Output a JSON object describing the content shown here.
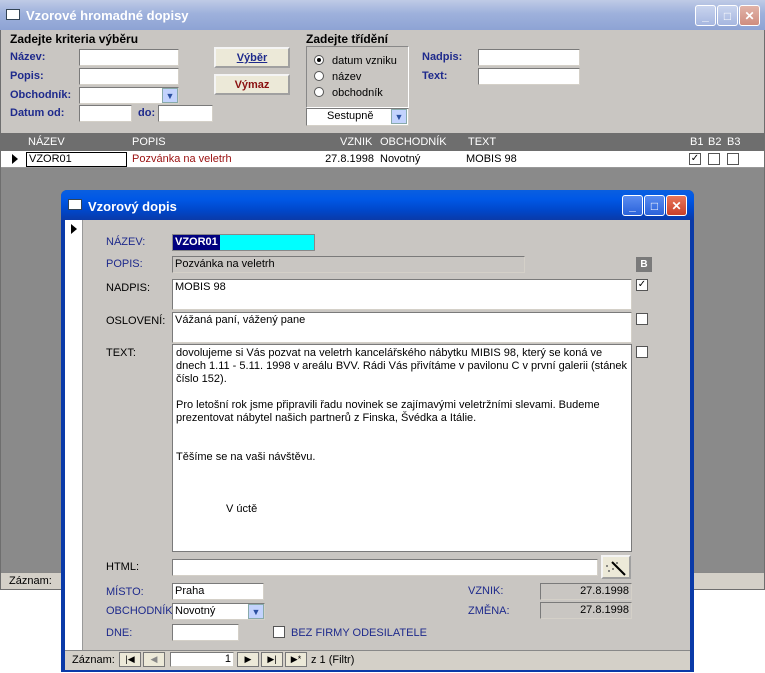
{
  "main_window": {
    "title": "Vzorové hromadné dopisy",
    "criteria": {
      "heading": "Zadejte kriteria výběru",
      "nazev_label": "Název:",
      "popis_label": "Popis:",
      "obchodnik_label": "Obchodník:",
      "datum_od_label": "Datum od:",
      "do_label": "do:"
    },
    "buttons": {
      "vyber": "Výběr",
      "vymaz": "Výmaz"
    },
    "sorting": {
      "heading": "Zadejte třídění",
      "options": [
        "datum vzniku",
        "název",
        "obchodník"
      ],
      "selected": 0,
      "order": "Sestupně"
    },
    "nadpis_label": "Nadpis:",
    "text_label": "Text:",
    "table": {
      "headers": [
        "NÁZEV",
        "POPIS",
        "VZNIK",
        "OBCHODNÍK",
        "TEXT",
        "B1",
        "B2",
        "B3"
      ],
      "row": {
        "nazev": "VZOR01",
        "popis": "Pozvánka na veletrh",
        "vznik": "27.8.1998",
        "obchodnik": "Novotný",
        "text": "MOBIS 98",
        "b1": "✓",
        "b2": "",
        "b3": ""
      }
    },
    "status_label": "Záznam:"
  },
  "dialog": {
    "title": "Vzorový dopis",
    "labels": {
      "nazev": "NÁZEV:",
      "popis": "POPIS:",
      "nadpis": "NADPIS:",
      "osloveni": "OSLOVENÍ:",
      "text": "TEXT:",
      "html": "HTML:",
      "misto": "MÍSTO:",
      "obchodnik": "OBCHODNÍK",
      "dne": "DNE:",
      "vznik": "VZNIK:",
      "zmena": "ZMĚNA:",
      "bez_firmy": "BEZ FIRMY ODESILATELE",
      "b_badge": "B"
    },
    "values": {
      "nazev": "VZOR01",
      "popis": "Pozvánka na veletrh",
      "nadpis": "MOBIS 98",
      "osloveni": "Vážaná paní, vážený pane",
      "text_p1": "dovolujeme si Vás pozvat na veletrh kancelářského nábytku MIBIS 98, který se koná ve dnech 1.11 - 5.11. 1998 v areálu BVV. Rádi Vás přivítáme v pavilonu C v první galerii (stánek číslo 152).",
      "text_p2": "Pro letošní rok jsme připravili řadu novinek se zajímavými veletržními slevami. Budeme prezentovat nábytel našich partnerů z Finska, Švédka a Itálie.",
      "text_p3": "Těšíme se na vaši návštěvu.",
      "text_p4": "V úctě",
      "html": "",
      "misto": "Praha",
      "obchodnik": "Novotný",
      "dne": "",
      "vznik": "27.8.1998",
      "zmena": "27.8.1998"
    },
    "checks": {
      "nadpis": "✓",
      "osloveni": "",
      "text": "",
      "bez_firmy": ""
    },
    "nav": {
      "label": "Záznam:",
      "record": "1",
      "total": "z 1 (Filtr)"
    }
  },
  "icons": [
    "minimize-icon",
    "maximize-icon",
    "close-icon",
    "record-selector-icon",
    "wand-icon",
    "dropdown-arrow-icon",
    "form-icon"
  ]
}
